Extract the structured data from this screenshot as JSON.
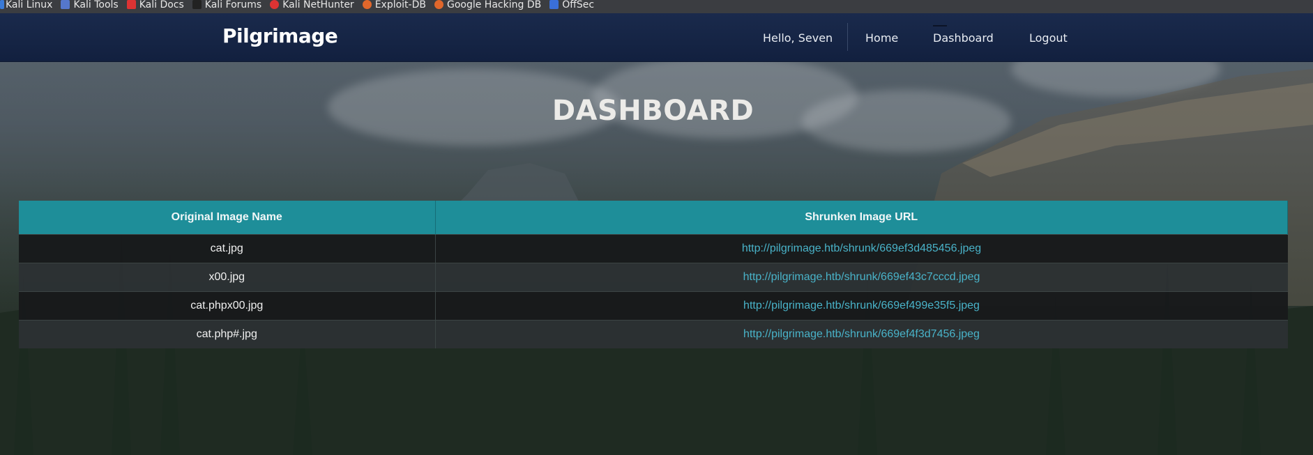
{
  "bookmarks": [
    {
      "label": "Kali Linux",
      "icon": "kali-icon",
      "color": "#3a7ad6"
    },
    {
      "label": "Kali Tools",
      "icon": "kali-tools-icon",
      "color": "#5577cc"
    },
    {
      "label": "Kali Docs",
      "icon": "kali-docs-icon",
      "color": "#d33"
    },
    {
      "label": "Kali Forums",
      "icon": "kali-forums-icon",
      "color": "#222"
    },
    {
      "label": "Kali NetHunter",
      "icon": "nethunter-icon",
      "color": "#d33"
    },
    {
      "label": "Exploit-DB",
      "icon": "exploitdb-icon",
      "color": "#e0672b"
    },
    {
      "label": "Google Hacking DB",
      "icon": "ghdb-icon",
      "color": "#e0672b"
    },
    {
      "label": "OffSec",
      "icon": "offsec-icon",
      "color": "#3a6fd8"
    }
  ],
  "navbar": {
    "brand": "Pilgrimage",
    "greeting": "Hello, Seven",
    "links": [
      "Home",
      "Dashboard",
      "Logout"
    ]
  },
  "page": {
    "title": "DASHBOARD"
  },
  "table": {
    "headers": [
      "Original Image Name",
      "Shrunken Image URL"
    ],
    "rows": [
      {
        "name": "cat.jpg",
        "url": "http://pilgrimage.htb/shrunk/669ef3d485456.jpeg"
      },
      {
        "name": "x00.jpg",
        "url": "http://pilgrimage.htb/shrunk/669ef43c7cccd.jpeg"
      },
      {
        "name": "cat.phpx00.jpg",
        "url": "http://pilgrimage.htb/shrunk/669ef499e35f5.jpeg"
      },
      {
        "name": "cat.php#.jpg",
        "url": "http://pilgrimage.htb/shrunk/669ef4f3d7456.jpeg"
      }
    ]
  },
  "colors": {
    "navbar": "#12203f",
    "table_header": "#1e8e99",
    "link": "#49b3c9"
  }
}
